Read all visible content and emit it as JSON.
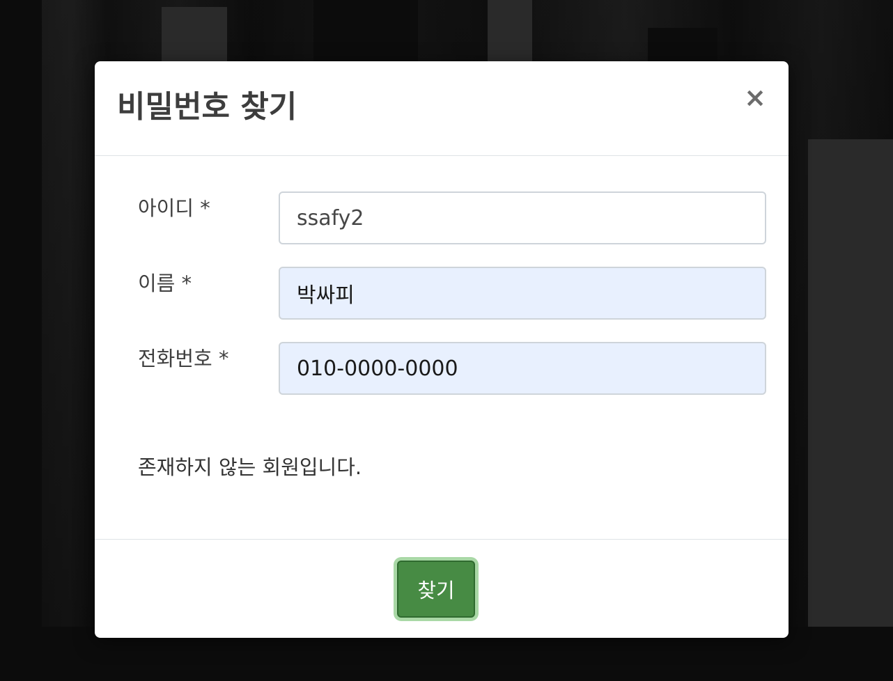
{
  "modal": {
    "title": "비밀번호 찾기",
    "close_symbol": "×",
    "close_icon": "close-icon"
  },
  "form": {
    "fields": [
      {
        "label": "아이디 *",
        "value": "ssafy2",
        "autofilled": false
      },
      {
        "label": "이름 *",
        "value": "박싸피",
        "autofilled": true
      },
      {
        "label": "전화번호 *",
        "value": "010-0000-0000",
        "autofilled": true
      }
    ]
  },
  "message": "존재하지 않는 회원입니다.",
  "footer": {
    "submit_label": "찾기"
  },
  "colors": {
    "primary_button": "#478b44",
    "button_focus_ring": "#a9d8a6",
    "autofill_background": "#e8f0fe"
  }
}
